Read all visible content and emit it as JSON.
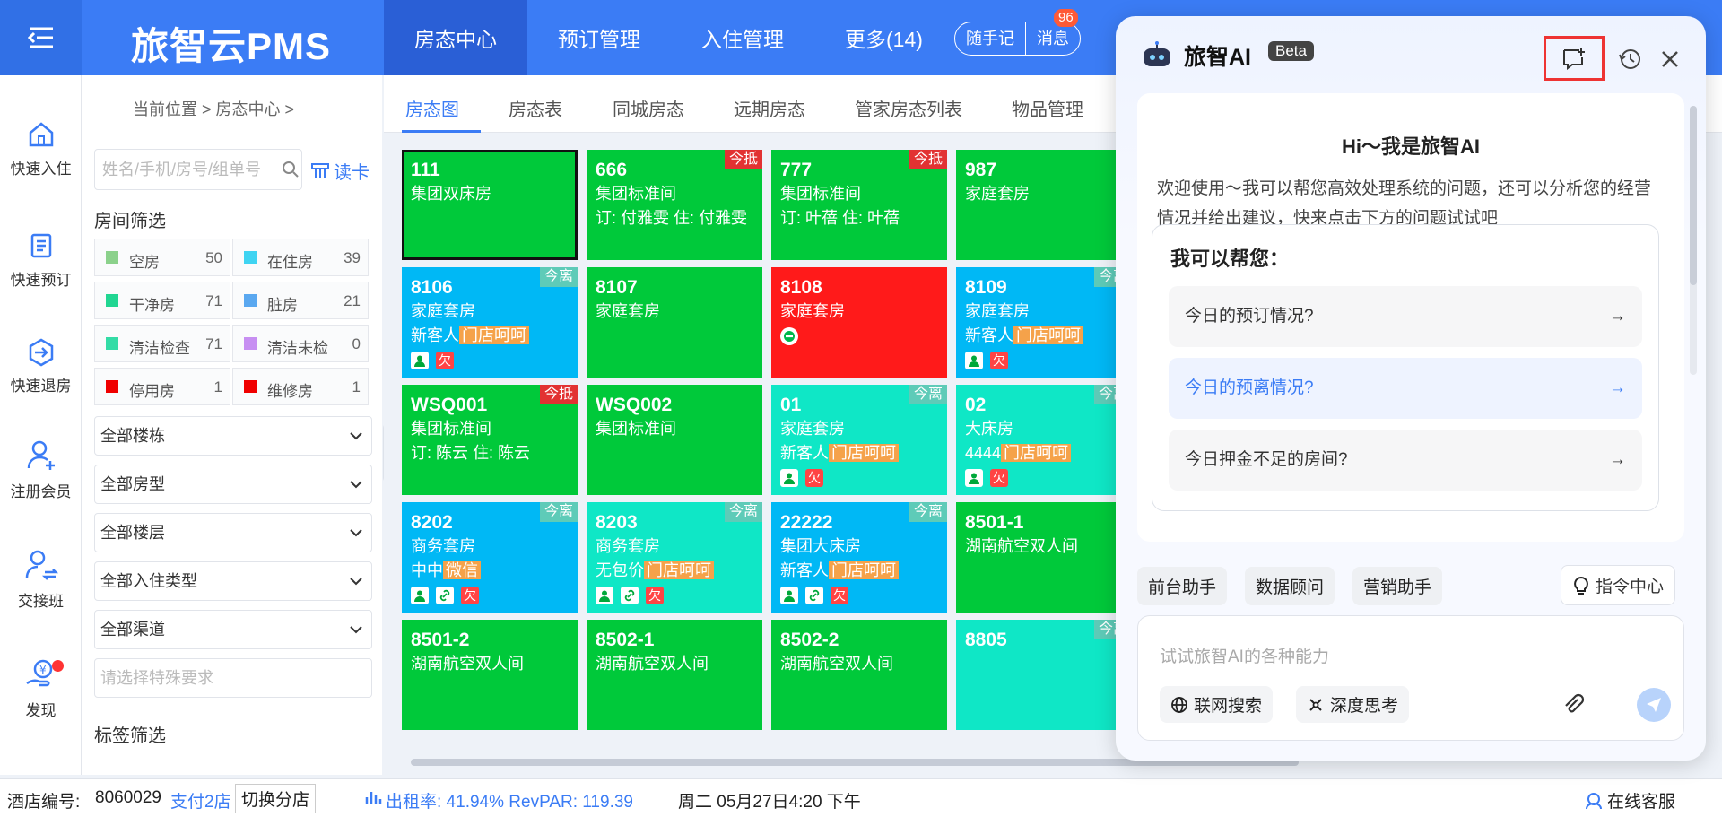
{
  "app": {
    "logo": "旅智云PMS"
  },
  "nav": [
    {
      "label": "房态中心",
      "active": true
    },
    {
      "label": "预订管理"
    },
    {
      "label": "入住管理"
    },
    {
      "label": "更多(14)"
    }
  ],
  "top_pills": {
    "notes": "随手记",
    "messages": "消息",
    "badge": "96"
  },
  "rail": [
    {
      "label": "快速入住",
      "icon": "home-icon"
    },
    {
      "label": "快速预订",
      "icon": "document-icon"
    },
    {
      "label": "快速退房",
      "icon": "checkout-icon"
    },
    {
      "label": "注册会员",
      "icon": "add-user-icon"
    },
    {
      "label": "交接班",
      "icon": "handover-icon"
    },
    {
      "label": "发现",
      "icon": "discover-icon"
    }
  ],
  "breadcrumb": "当前位置 > 房态中心 >",
  "search": {
    "placeholder": "姓名/手机/房号/组单号",
    "readcard": "读卡"
  },
  "filter_title": "房间筛选",
  "stats": [
    {
      "label": "空房",
      "count": "50",
      "color": "#8bd18b"
    },
    {
      "label": "在住房",
      "count": "39",
      "color": "#3fd4f2"
    },
    {
      "label": "干净房",
      "count": "71",
      "color": "#21d692"
    },
    {
      "label": "脏房",
      "count": "21",
      "color": "#5aa8f0"
    },
    {
      "label": "清洁检查",
      "count": "71",
      "color": "#33dca6"
    },
    {
      "label": "清洁未检",
      "count": "0",
      "color": "#c78ff2"
    },
    {
      "label": "停用房",
      "count": "1",
      "color": "#f00000"
    },
    {
      "label": "维修房",
      "count": "1",
      "color": "#f00000"
    }
  ],
  "selects": [
    "全部楼栋",
    "全部房型",
    "全部楼层",
    "全部入住类型",
    "全部渠道"
  ],
  "special_placeholder": "请选择特殊要求",
  "tag_filter_title": "标签筛选",
  "tabs": [
    "房态图",
    "房态表",
    "同城房态",
    "远期房态",
    "管家房态列表",
    "物品管理"
  ],
  "rooms": [
    {
      "no": "111",
      "type": "集团双床房",
      "color": "green",
      "selected": true
    },
    {
      "no": "666",
      "type": "集团标准间",
      "line3": "订: 付雅雯 住: 付雅雯",
      "color": "green",
      "tag": "今抵",
      "tagColor": "red"
    },
    {
      "no": "777",
      "type": "集团标准间",
      "line3": "订: 叶蓓 住: 叶蓓",
      "color": "green",
      "tag": "今抵",
      "tagColor": "red"
    },
    {
      "no": "987",
      "type": "家庭套房",
      "color": "green"
    },
    {
      "no": "8106",
      "type": "家庭套房",
      "guest": "新客人",
      "chip": "门店呵呵",
      "color": "blue",
      "tag": "今离",
      "tagColor": "teal",
      "icons": [
        "person",
        "owe"
      ]
    },
    {
      "no": "8107",
      "type": "家庭套房",
      "color": "green"
    },
    {
      "no": "8108",
      "type": "家庭套房",
      "color": "red",
      "icons": [
        "stop"
      ]
    },
    {
      "no": "8109",
      "type": "家庭套房",
      "guest": "新客人",
      "chip": "门店呵呵",
      "color": "blue",
      "tag": "今离",
      "tagColor": "teal",
      "icons": [
        "person",
        "owe"
      ]
    },
    {
      "no": "WSQ001",
      "type": "集团标准间",
      "line3": "订: 陈云 住: 陈云",
      "color": "green",
      "tag": "今抵",
      "tagColor": "red"
    },
    {
      "no": "WSQ002",
      "type": "集团标准间",
      "color": "green"
    },
    {
      "no": "01",
      "type": "家庭套房",
      "guest": "新客人",
      "chip": "门店呵呵",
      "color": "teal",
      "tag": "今离",
      "tagColor": "teal",
      "icons": [
        "person",
        "owe"
      ]
    },
    {
      "no": "02",
      "type": "大床房",
      "guest": "4444",
      "chip": "门店呵呵",
      "color": "teal",
      "tag": "今离",
      "tagColor": "teal",
      "icons": [
        "person",
        "owe"
      ]
    },
    {
      "no": "8202",
      "type": "商务套房",
      "guest": "中中",
      "chip": "微信",
      "color": "blue",
      "tag": "今离",
      "tagColor": "teal",
      "icons": [
        "person",
        "link",
        "owe"
      ]
    },
    {
      "no": "8203",
      "type": "商务套房",
      "guest": "无包价",
      "chip": "门店呵呵",
      "color": "teal",
      "tag": "今离",
      "tagColor": "teal",
      "icons": [
        "person",
        "link",
        "owe"
      ]
    },
    {
      "no": "22222",
      "type": "集团大床房",
      "guest": "新客人",
      "chip": "门店呵呵",
      "color": "blue",
      "tag": "今离",
      "tagColor": "teal",
      "icons": [
        "person",
        "link",
        "owe"
      ]
    },
    {
      "no": "8501-1",
      "type": "湖南航空双人间",
      "color": "green"
    },
    {
      "no": "8501-2",
      "type": "湖南航空双人间",
      "color": "green"
    },
    {
      "no": "8502-1",
      "type": "湖南航空双人间",
      "color": "green"
    },
    {
      "no": "8502-2",
      "type": "湖南航空双人间",
      "color": "green"
    },
    {
      "no": "8805",
      "type": "",
      "color": "teal",
      "tag": "今离",
      "tagColor": "teal"
    }
  ],
  "room_icon_text": {
    "owe": "欠"
  },
  "status": {
    "hotel_label": "酒店编号:",
    "hotel_no": "8060029",
    "pay": "支付2店",
    "switch": "切换分店",
    "occupancy": "出租率: 41.94% RevPAR: 119.39",
    "datetime": "周二 05月27日4:20 下午",
    "service": "在线客服"
  },
  "ai": {
    "title": "旅智AI",
    "beta": "Beta",
    "greeting": "Hi～我是旅智AI",
    "desc": "欢迎使用～我可以帮您高效处理系统的问题，还可以分析您的经营情况并给出建议，快来点击下方的问题试试吧",
    "help_title": "我可以帮您：",
    "questions": [
      "今日的预订情况?",
      "今日的预离情况?",
      "今日押金不足的房间?"
    ],
    "chips": [
      "前台助手",
      "数据顾问",
      "营销助手"
    ],
    "command": "指令中心",
    "input_placeholder": "试试旅智AI的各种能力",
    "tools": [
      "联网搜索",
      "深度思考"
    ]
  }
}
